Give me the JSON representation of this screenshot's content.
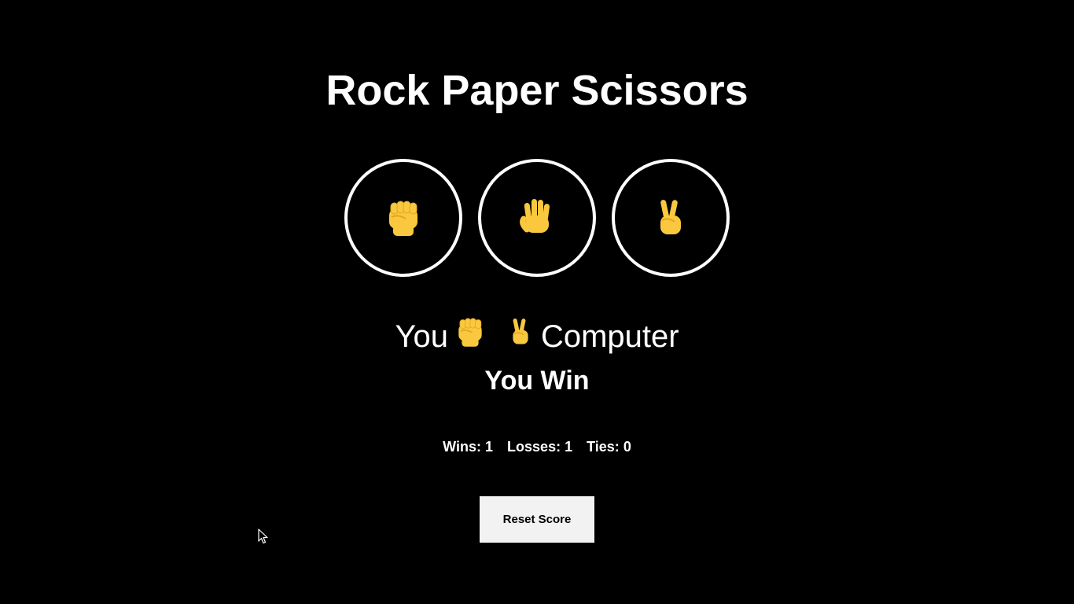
{
  "title": "Rock Paper Scissors",
  "moves": [
    {
      "name": "rock",
      "icon": "fist-icon"
    },
    {
      "name": "paper",
      "icon": "raised-hand-icon"
    },
    {
      "name": "scissors",
      "icon": "victory-hand-icon"
    }
  ],
  "picks": {
    "you_label": "You",
    "you_icon": "fist-icon",
    "computer_icon": "victory-hand-icon",
    "computer_label": "Computer"
  },
  "result": "You Win",
  "score": {
    "wins_label": "Wins:",
    "wins": "1",
    "losses_label": "Losses:",
    "losses": "1",
    "ties_label": "Ties:",
    "ties": "0"
  },
  "reset_label": "Reset Score",
  "colors": {
    "background": "#000000",
    "text": "#ffffff",
    "emoji_skin": "#f9c83e",
    "emoji_shade": "#e2a520",
    "button_bg": "#f2f2f2"
  }
}
